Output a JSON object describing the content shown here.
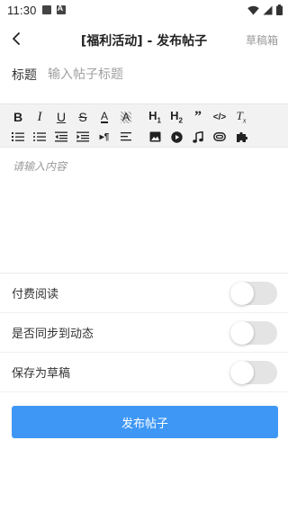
{
  "status_bar": {
    "time": "11:30"
  },
  "nav": {
    "title": "[福利活动] - 发布帖子",
    "drafts": "草稿箱"
  },
  "form": {
    "title_label": "标题",
    "title_placeholder": "输入帖子标题",
    "content_placeholder": "请输入内容"
  },
  "toolbar": {
    "row1": [
      {
        "name": "bold-icon",
        "glyph": "B"
      },
      {
        "name": "italic-icon",
        "glyph": "I"
      },
      {
        "name": "underline-icon",
        "glyph": "U"
      },
      {
        "name": "strikethrough-icon",
        "glyph": "S"
      },
      {
        "name": "font-color-icon",
        "glyph": "A"
      },
      {
        "name": "background-color-icon",
        "glyph": "A"
      },
      {
        "name": "heading1-icon",
        "glyph": "H1"
      },
      {
        "name": "heading2-icon",
        "glyph": "H2"
      },
      {
        "name": "blockquote-icon",
        "glyph": "99"
      },
      {
        "name": "code-icon",
        "glyph": "</>"
      },
      {
        "name": "clear-format-icon",
        "glyph": "Tx"
      }
    ],
    "row2": [
      "ordered-list-icon",
      "unordered-list-icon",
      "outdent-icon",
      "indent-icon",
      "text-direction-icon",
      "align-icon",
      "image-icon",
      "video-icon",
      "music-icon",
      "attachment-icon",
      "plugin-icon"
    ]
  },
  "toggles": [
    {
      "label": "付费阅读",
      "on": false
    },
    {
      "label": "是否同步到动态",
      "on": false
    },
    {
      "label": "保存为草稿",
      "on": false
    }
  ],
  "submit_label": "发布帖子",
  "colors": {
    "accent": "#3e97f5",
    "switch_off": "#e4e4e4",
    "toolbar_bg": "#f2f2f2"
  }
}
